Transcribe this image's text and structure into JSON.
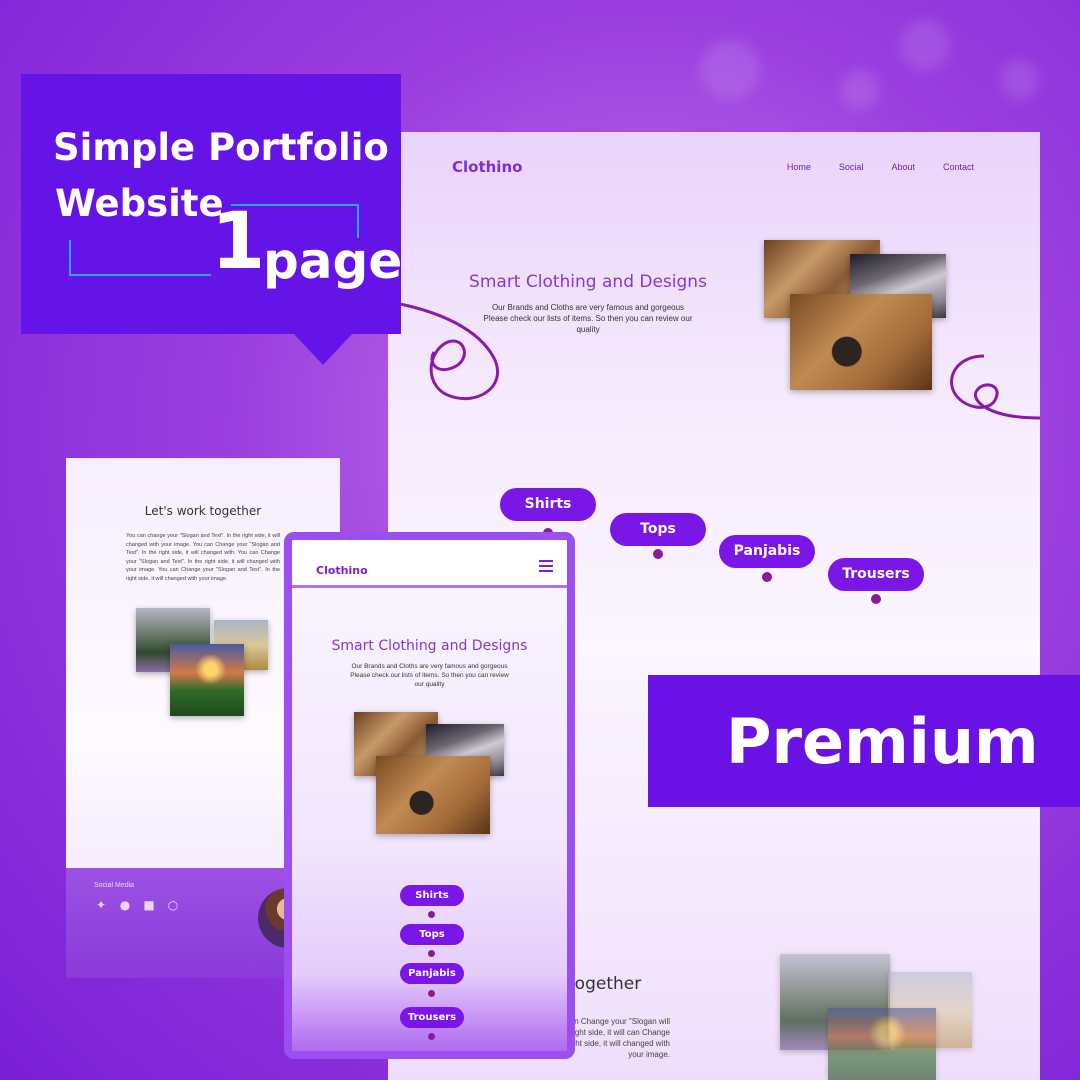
{
  "banner": {
    "line1": "Simple Portfolio",
    "line2": "Website",
    "number": "1",
    "unit": "page"
  },
  "premium_label": "Premium",
  "desktop": {
    "logo": "Clothino",
    "nav": [
      "Home",
      "Social",
      "About",
      "Contact"
    ],
    "hero_title": "Smart Clothing and Designs",
    "hero_subtitle": "Our Brands and Cloths are very famous and gorgeous Please check our lists of items. So then you can review our quality",
    "categories": [
      "Shirts",
      "Tops",
      "Panjabis",
      "Trousers"
    ],
    "about_title": "together",
    "about_text": "Text\". In the right side, it can Change your \"Slogan will changed with You can \". In the right side, it will can Change your \"Slogan and Text\". In the right side, it will changed with your image."
  },
  "left_panel": {
    "title": "Let's work together",
    "body": "You can change your \"Slogan and Text\". In the right side, it will changed with your image. You can Change your \"Slogan and Text\". In the right side, it will changed with. You can Change your \"Slogan and Text\". In the right side, it will changed with your image. You can Change your \"Slogan and Text\". In the right side, it will changed with your image.",
    "social_label": "Social Media",
    "social_icons": [
      "twitter-icon",
      "facebook-icon",
      "chat-icon",
      "whatsapp-icon"
    ]
  },
  "mobile": {
    "logo": "Clothino",
    "hero_title": "Smart Clothing and Designs",
    "hero_subtitle": "Our Brands and Cloths are very famous and gorgeous Please check our lists of items. So then you can review our quality",
    "categories": [
      "Shirts",
      "Tops",
      "Panjabis",
      "Trousers"
    ]
  },
  "colors": {
    "accent": "#6514e8",
    "pill": "#7a16e6",
    "logo": "#7d2fd1",
    "guide_line": "#2aa6ff"
  }
}
